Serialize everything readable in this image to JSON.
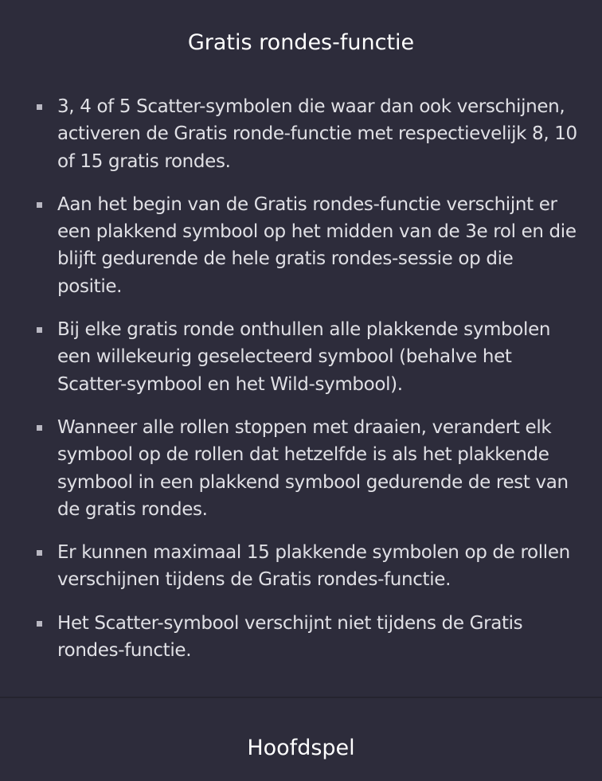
{
  "header": {
    "title": "Gratis rondes-functie"
  },
  "rules": [
    "3, 4 of 5 Scatter-symbolen die waar dan ook verschijnen, activeren de Gratis ronde-functie met respectievelijk 8, 10 of 15 gratis rondes.",
    "Aan het begin van de Gratis rondes-functie verschijnt er een plakkend symbool op het midden van de 3e rol en die blijft gedurende de hele gratis rondes-sessie op die positie.",
    "Bij elke gratis ronde onthullen alle plakkende symbolen een willekeurig geselecteerd symbool (behalve het Scatter-symbool en het Wild-symbool).",
    "Wanneer alle rollen stoppen met draaien, verandert elk symbool op de rollen dat hetzelfde is als het plakkende symbool in een plakkend symbool gedurende de rest van de gratis rondes.",
    "Er kunnen maximaal 15 plakkende symbolen op de rollen verschijnen tijdens de Gratis rondes-functie.",
    "Het Scatter-symbool verschijnt niet tijdens de Gratis rondes-functie."
  ],
  "footer": {
    "next_section_label": "Hoofdspel"
  },
  "colors": {
    "background": "#2d2c3b",
    "text": "#e0e0e5",
    "title": "#ffffff",
    "bullet": "#b9b8c2"
  }
}
